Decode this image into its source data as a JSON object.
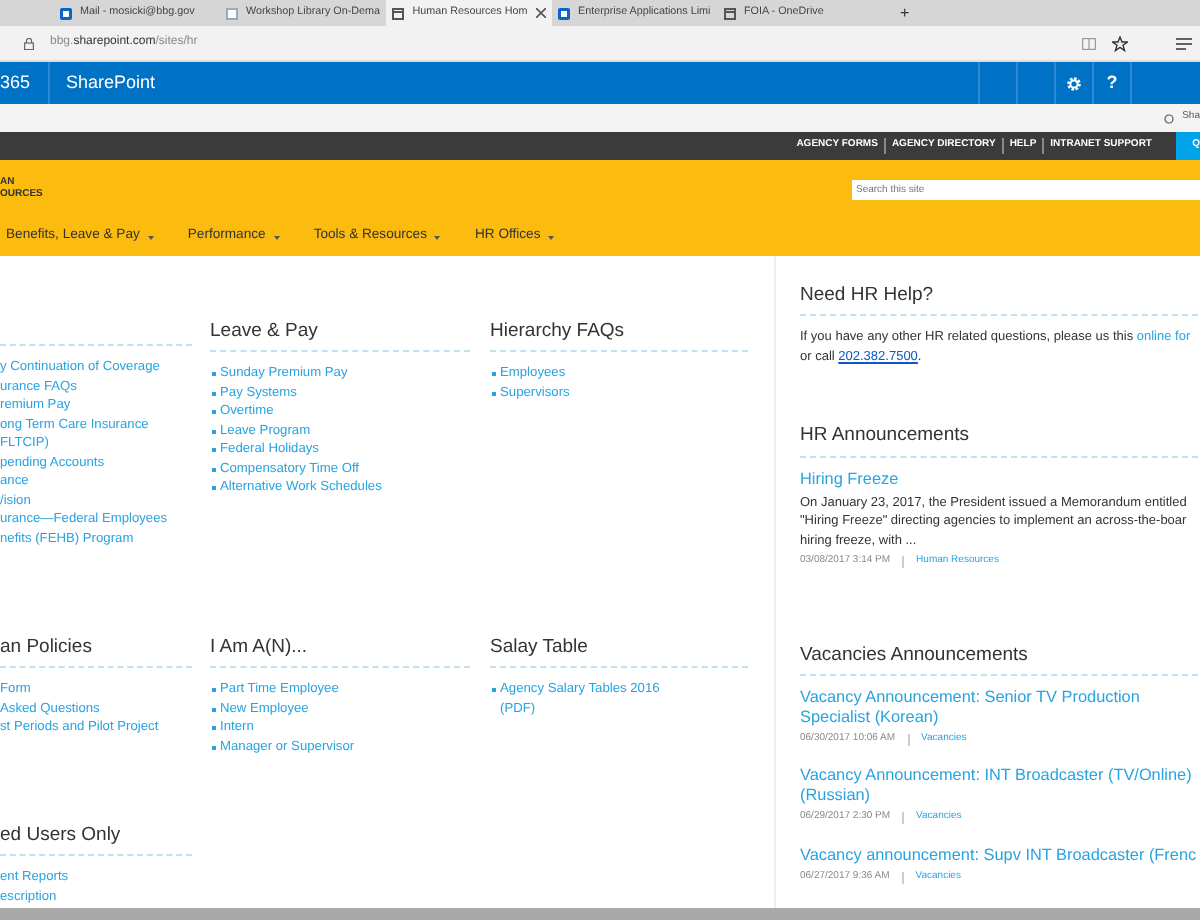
{
  "browser_tabs": [
    {
      "label": "Mail - mosicki@bbg.gov",
      "selected": false,
      "kind": "mail"
    },
    {
      "label": "Workshop Library On-Dema",
      "selected": false,
      "kind": "page"
    },
    {
      "label": "Human Resources Hom",
      "selected": true,
      "kind": "window"
    },
    {
      "label": "Enterprise Applications Limi",
      "selected": false,
      "kind": "mail"
    },
    {
      "label": "FOIA - OneDrive",
      "selected": false,
      "kind": "window"
    }
  ],
  "new_tab": "+",
  "address": {
    "prefix": "bbg.",
    "domain": "sharepoint.com",
    "path": "/sites/hr"
  },
  "suite_bar": {
    "app_number": "365",
    "app_name": "SharePoint",
    "help": "?"
  },
  "share": "Sha",
  "top_links": [
    "AGENCY FORMS",
    "AGENCY DIRECTORY",
    "HELP",
    "INTRANET SUPPORT"
  ],
  "quick_tab": "Q",
  "logo": [
    "AN",
    "OURCES"
  ],
  "search": {
    "placeholder": "Search this site"
  },
  "nav": [
    "Benefits, Leave & Pay",
    "Performance",
    "Tools & Resources",
    "HR Offices"
  ],
  "sections": [
    {
      "kind": "cut",
      "links": [
        "y Continuation of Coverage",
        "urance FAQs",
        "remium Pay",
        "ong Term Care Insurance",
        "FLTCIP)",
        "pending Accounts",
        "ance",
        "/ision",
        "urance—Federal Employees",
        "nefits (FEHB) Program"
      ]
    },
    {
      "title": "Leave & Pay",
      "kind": "list",
      "links": [
        "Sunday Premium Pay",
        "Pay Systems",
        "Overtime",
        "Leave Program",
        "Federal Holidays",
        "Compensatory Time Off",
        "Alternative Work Schedules"
      ]
    },
    {
      "title": "Hierarchy FAQs",
      "kind": "list",
      "links": [
        "Employees",
        "Supervisors"
      ]
    },
    {
      "title": "an Policies",
      "kind": "cut",
      "links": [
        "Form",
        "Asked Questions",
        "st Periods and Pilot Project"
      ]
    },
    {
      "title": "I Am A(N)...",
      "kind": "list",
      "links": [
        "Part Time Employee",
        "New Employee",
        "Intern",
        "Manager or Supervisor"
      ]
    },
    {
      "title": "Salay Table",
      "kind": "list",
      "links": [
        "Agency Salary Tables 2016 (PDF)"
      ]
    },
    {
      "title": "ed Users Only",
      "kind": "cut",
      "links": [
        "ent Reports",
        "escription"
      ]
    }
  ],
  "help": {
    "title": "Need HR Help?",
    "text": "If you have any other HR related questions, please us this",
    "link": "online for",
    "text2": "or call",
    "phone": "202.382.7500",
    "end": "."
  },
  "announcements": {
    "title": "HR Announcements",
    "items": [
      {
        "title": "Hiring Freeze",
        "body": "On January 23, 2017, the President issued a Memorandum entitled \"Hiring Freeze\" directing agencies to implement an across-the-boar hiring freeze, with ...",
        "date": "03/08/2017 3:14 PM",
        "category": "Human Resources"
      }
    ]
  },
  "vacancies": {
    "title": "Vacancies Announcements",
    "items": [
      {
        "title": "Vacancy Announcement: Senior TV Production Specialist (Korean)",
        "date": "06/30/2017 10:06 AM",
        "category": "Vacancies"
      },
      {
        "title": "Vacancy Announcement: INT Broadcaster (TV/Online) (Russian)",
        "date": "06/29/2017 2:30 PM",
        "category": "Vacancies"
      },
      {
        "title": "Vacancy announcement: Supv INT Broadcaster (Frenc",
        "date": "06/27/2017 9:36 AM",
        "category": "Vacancies"
      }
    ]
  }
}
